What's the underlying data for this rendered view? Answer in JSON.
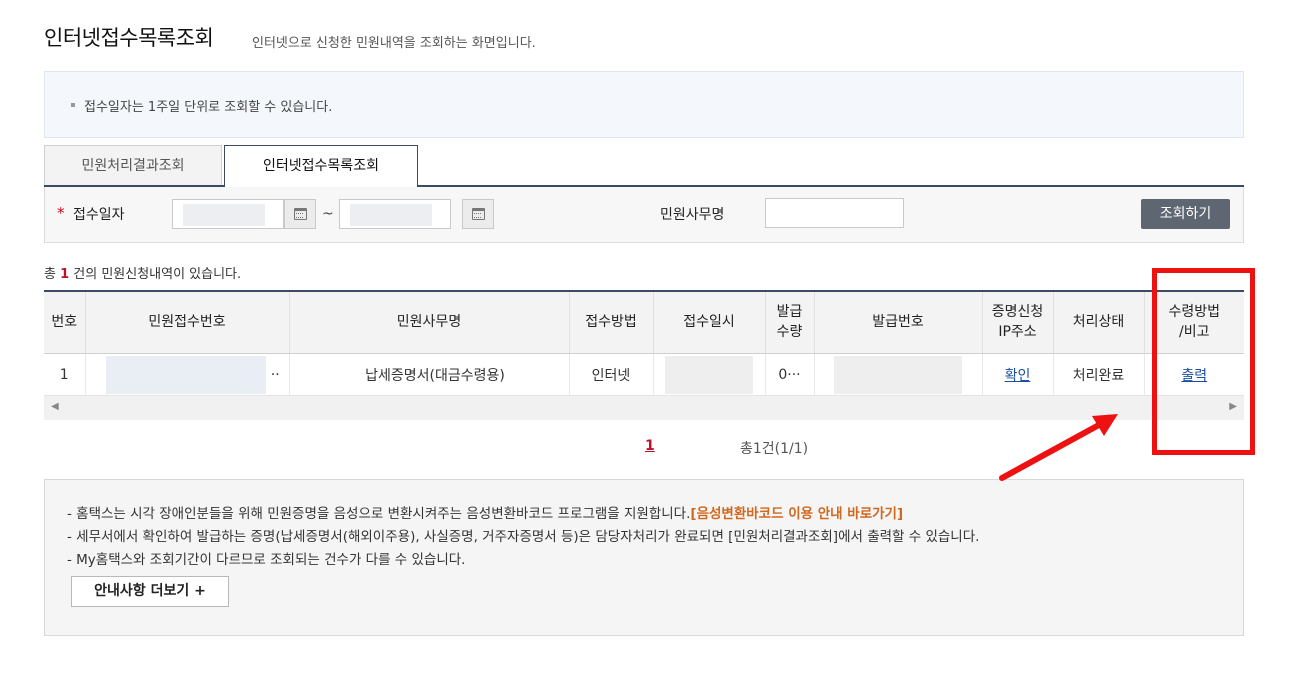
{
  "header": {
    "title": "인터넷접수목록조회",
    "description": "인터넷으로 신청한 민원내역을 조회하는 화면입니다."
  },
  "info": {
    "text": "접수일자는 1주일 단위로 조회할 수 있습니다."
  },
  "tabs": [
    {
      "label": "민원처리결과조회",
      "active": false
    },
    {
      "label": "인터넷접수목록조회",
      "active": true
    }
  ],
  "search": {
    "date_label": "접수일자",
    "required_mark": "*",
    "tilde": "~",
    "service_label": "민원사무명",
    "button_label": "조회하기"
  },
  "result": {
    "prefix": "총 ",
    "count": "1",
    "suffix": " 건의 민원신청내역이 있습니다."
  },
  "table": {
    "headers": [
      "번호",
      "민원접수번호",
      "민원사무명",
      "접수방법",
      "접수일시",
      "발급\n수량",
      "발급번호",
      "증명신청\nIP주소",
      "처리상태",
      "수령방법\n/비고"
    ],
    "rows": [
      {
        "no": "1",
        "receipt_suffix": "··",
        "service": "납세증명서(대금수령용)",
        "method": "인터넷",
        "qty": "0···",
        "ip_link": "확인",
        "status": "처리완료",
        "remark_link": "출력"
      }
    ]
  },
  "pagination": {
    "current": "1",
    "total": "총1건(1/1)"
  },
  "notice": {
    "line1_text": "- 홈택스는 시각 장애인분들을 위해 민원증명을 음성으로 변환시켜주는 음성변환바코드 프로그램을 지원합니다.",
    "line1_link": "[음성변환바코드 이용 안내 바로가기]",
    "line2": "- 세무서에서 확인하여 발급하는 증명(납세증명서(해외이주용), 사실증명, 거주자증명서 등)은 담당자처리가 완료되면 [민원처리결과조회]에서 출력할 수 있습니다.",
    "line3": "- My홈택스와 조회기간이 다르므로 조회되는 건수가 다를 수 있습니다.",
    "more_button": "안내사항 더보기 +"
  },
  "colors": {
    "accent_navy": "#3d4a66",
    "highlight_red": "#ee1111",
    "link_blue": "#1a4fa0",
    "count_red": "#c0112b",
    "notice_orange": "#d2681e"
  }
}
